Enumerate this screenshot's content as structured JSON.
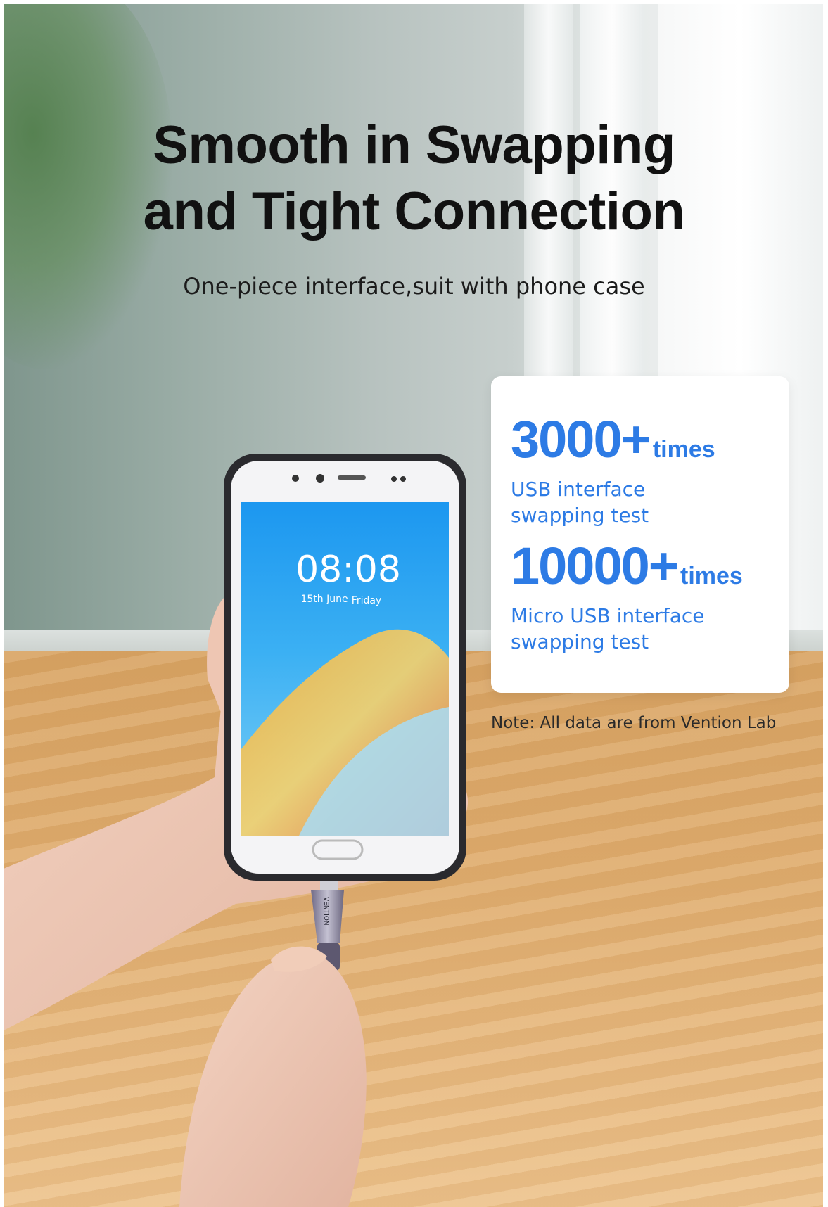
{
  "headline": {
    "line1": "Smooth in Swapping",
    "line2": "and Tight Connection"
  },
  "subheadline": "One-piece interface,suit with phone case",
  "stats": [
    {
      "value": "3000+",
      "unit": "times",
      "description_line1": "USB interface",
      "description_line2": "swapping test"
    },
    {
      "value": "10000+",
      "unit": "times",
      "description_line1": "Micro USB interface",
      "description_line2": "swapping test"
    }
  ],
  "note": "Note: All data are from Vention Lab",
  "phone_screen": {
    "clock": "08:08",
    "date": "15th June",
    "day": "Friday"
  },
  "cable_brand": "VENTION",
  "colors": {
    "accent_blue": "#2d7be5",
    "headline_text": "#111111",
    "card_background": "#ffffff"
  }
}
